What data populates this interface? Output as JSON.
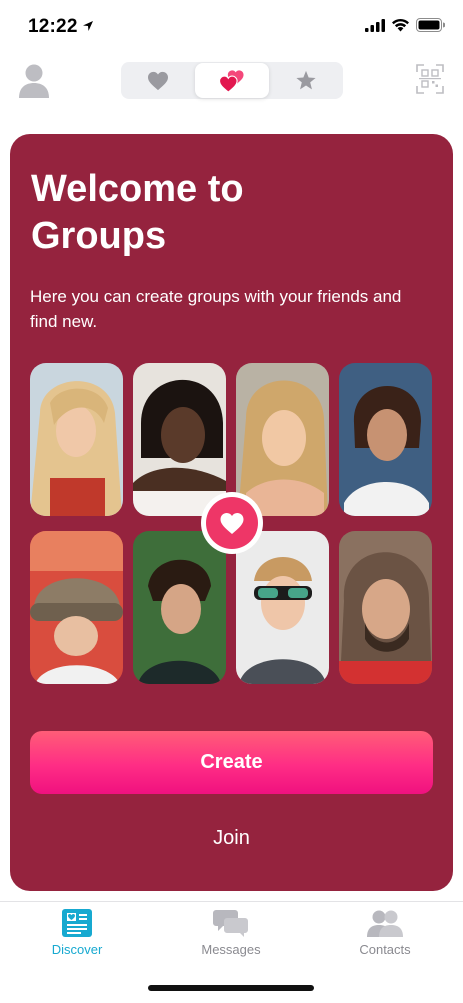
{
  "status_bar": {
    "time": "12:22"
  },
  "top_nav": {
    "segments": [
      "favorites-heart",
      "groups-hearts",
      "starred"
    ],
    "selected_segment": 1
  },
  "card": {
    "title": "Welcome to\nGroups",
    "subtitle": "Here you can create groups with your friends and find new.",
    "create_label": "Create",
    "join_label": "Join"
  },
  "tab_bar": {
    "items": [
      {
        "label": "Discover",
        "icon": "discover-icon",
        "active": true
      },
      {
        "label": "Messages",
        "icon": "messages-icon",
        "active": false
      },
      {
        "label": "Contacts",
        "icon": "contacts-icon",
        "active": false
      }
    ]
  },
  "colors": {
    "card_bg": "#95233e",
    "accent_pink": "#ee3667",
    "active_tab": "#17a9d0",
    "inactive_tab": "#8a8a90"
  }
}
